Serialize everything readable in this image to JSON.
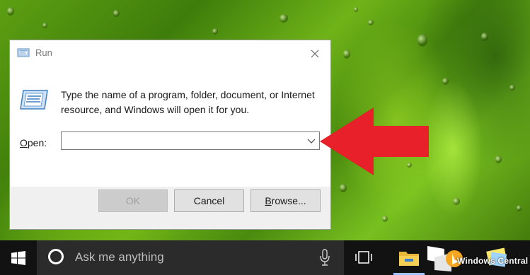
{
  "dialog": {
    "title": "Run",
    "description": "Type the name of a program, folder, document, or Internet resource, and Windows will open it for you.",
    "open_label_key": "O",
    "open_label_rest": "pen:",
    "open_value": "",
    "buttons": {
      "ok": "OK",
      "cancel": "Cancel",
      "browse_key": "B",
      "browse_rest": "rowse..."
    }
  },
  "taskbar": {
    "search_placeholder": "Ask me anything"
  },
  "watermark": "Windows Central",
  "colors": {
    "arrow": "#e8202a",
    "taskbar": "#121212",
    "search_box": "#2b2b2b"
  },
  "icons": [
    "run-icon",
    "close-icon",
    "chevron-down-icon",
    "windows-start-icon",
    "cortana-icon",
    "microphone-icon",
    "task-view-icon",
    "file-explorer-icon",
    "windows-central-logo",
    "sticky-notes-icon",
    "red-arrow"
  ]
}
